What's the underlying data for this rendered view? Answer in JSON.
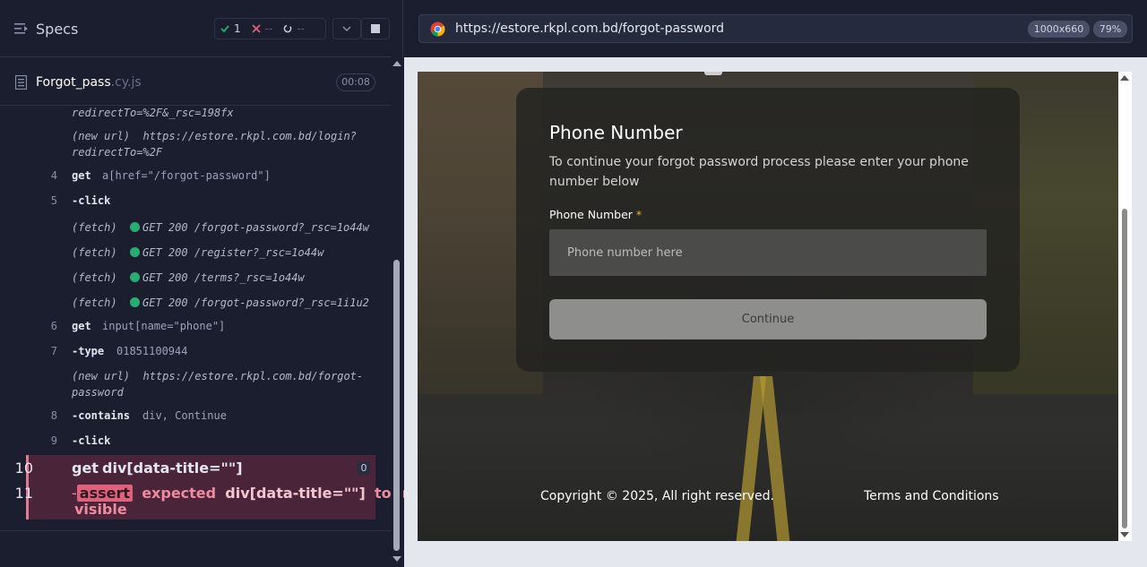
{
  "specs": {
    "title": "Specs",
    "passed": "1",
    "failed_placeholder": "--",
    "pending_placeholder": "--"
  },
  "file": {
    "name": "Forgot_pass",
    "ext": ".cy.js",
    "duration": "00:08"
  },
  "log": {
    "line_a": "redirectTo=%2F&_rsc=198fx",
    "newurl1_key": "(new url)",
    "newurl1_val": "https://estore.rkpl.com.bd/login?",
    "newurl1_cont": "redirectTo=%2F",
    "c4_num": "4",
    "c4_name": "get",
    "c4_msg": "a[href=\"/forgot-password\"]",
    "c5_num": "5",
    "c5_name": "-click",
    "fetch_key": "(fetch)",
    "f1": "GET 200 /forgot-password?_rsc=1o44w",
    "f2": "GET 200 /register?_rsc=1o44w",
    "f3": "GET 200 /terms?_rsc=1o44w",
    "f4": "GET 200 /forgot-password?_rsc=1i1u2",
    "c6_num": "6",
    "c6_name": "get",
    "c6_msg": "input[name=\"phone\"]",
    "c7_num": "7",
    "c7_name": "-type",
    "c7_msg": "01851100944",
    "newurl2_key": "(new url)",
    "newurl2_val": "https://estore.rkpl.com.bd/forgot-",
    "newurl2_cont": "password",
    "c8_num": "8",
    "c8_name": "-contains",
    "c8_msg": "div, Continue",
    "c9_num": "9",
    "c9_name": "-click",
    "c10_num": "10",
    "c10_name": "get",
    "c10_msg": "div[data-title=\"\"]",
    "c10_badge": "0",
    "c11_num": "11",
    "c11_dash": "-",
    "c11_chip": "assert",
    "c11_expected": "expected",
    "c11_subject": "div[data-title=\"\"]",
    "c11_tobe": "to be",
    "c11_visible": "visible"
  },
  "browser": {
    "url": "https://estore.rkpl.com.bd/forgot-password",
    "viewport": "1000x660",
    "zoom": "79%"
  },
  "page": {
    "title": "Phone Number",
    "description": "To continue your forgot password process please enter your phone number below",
    "field_label": "Phone Number",
    "required_mark": "*",
    "placeholder": "Phone number here",
    "continue": "Continue",
    "copyright": "Copyright © 2025, All right reserved.",
    "terms": "Terms and Conditions"
  },
  "colors": {
    "pass": "#27ad71",
    "fail": "#e0617c",
    "reporter_bg": "#1b1e2e"
  }
}
